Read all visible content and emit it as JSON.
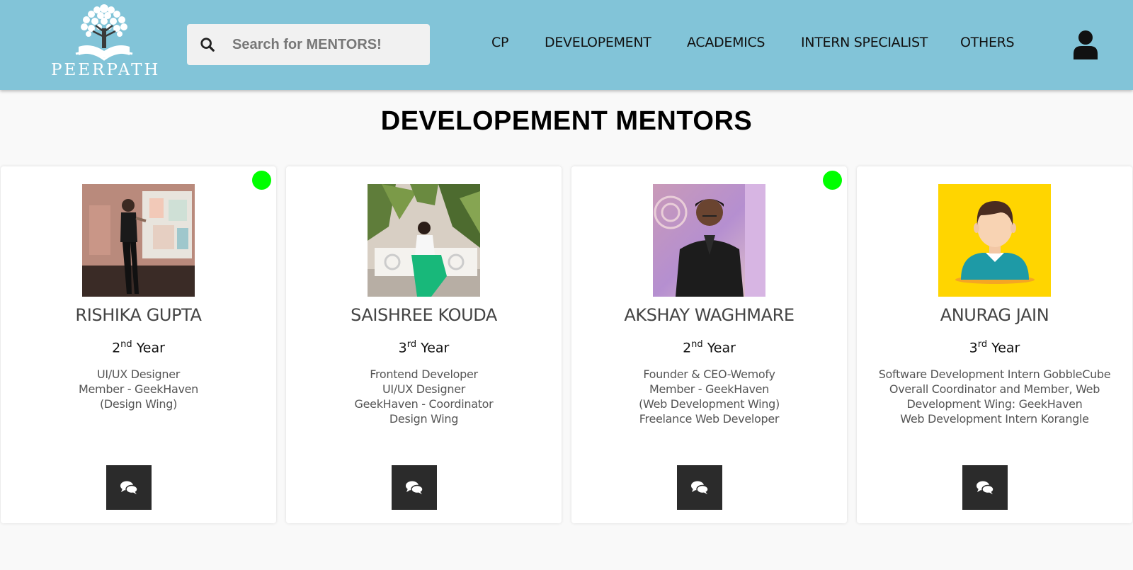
{
  "header": {
    "logo_text": "PEERPATH",
    "search": {
      "placeholder": "Search for MENTORS!",
      "value": ""
    },
    "nav": [
      {
        "label": "CP"
      },
      {
        "label": "DEVELOPEMENT"
      },
      {
        "label": "ACADEMICS"
      },
      {
        "label": "INTERN SPECIALIST"
      },
      {
        "label": "OTHERS"
      }
    ]
  },
  "page": {
    "title": "DEVELOPEMENT MENTORS"
  },
  "colors": {
    "header_bg": "#82c4d8",
    "online": "#00ff00",
    "chat_button": "#2b2b2b"
  },
  "mentors": [
    {
      "name": "RISHIKA GUPTA",
      "year_num": "2",
      "year_suffix": "nd",
      "year_word": "Year",
      "online": true,
      "desc": [
        "UI/UX Designer",
        "Member - GeekHaven",
        "(Design Wing)"
      ],
      "photo": "photo-stage-speaker"
    },
    {
      "name": "SAISHREE KOUDA",
      "year_num": "3",
      "year_suffix": "rd",
      "year_word": "Year",
      "online": false,
      "desc": [
        "Frontend Developer",
        "UI/UX Designer",
        "GeekHaven - Coordinator",
        "Design Wing"
      ],
      "photo": "photo-bench-plants"
    },
    {
      "name": "AKSHAY WAGHMARE",
      "year_num": "2",
      "year_suffix": "nd",
      "year_word": "Year",
      "online": true,
      "desc": [
        "Founder & CEO-Wemofy",
        "Member - GeekHaven",
        "(Web Development Wing)",
        "Freelance Web Developer"
      ],
      "photo": "photo-portrait-hoodie"
    },
    {
      "name": "ANURAG JAIN",
      "year_num": "3",
      "year_suffix": "rd",
      "year_word": "Year",
      "online": false,
      "desc": [
        "Software Development Intern GobbleCube",
        "Overall Coordinator and Member, Web",
        "Development Wing: GeekHaven",
        "Web Development Intern Korangle"
      ],
      "photo": "default-avatar"
    }
  ]
}
